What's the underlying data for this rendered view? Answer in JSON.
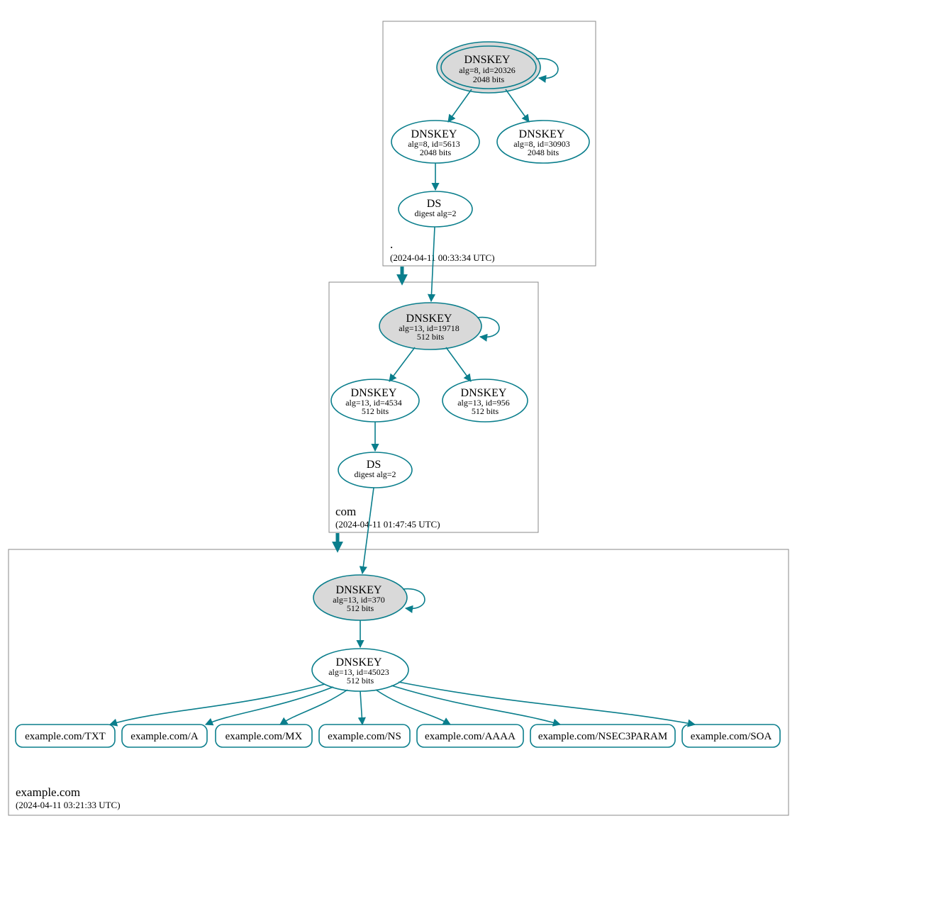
{
  "colors": {
    "edge": "#0a7e8c",
    "ksk_fill": "#d9d9d9",
    "box_stroke": "#888888"
  },
  "zones": {
    "root": {
      "name": ".",
      "timestamp": "(2024-04-11 00:33:34 UTC)"
    },
    "com": {
      "name": "com",
      "timestamp": "(2024-04-11 01:47:45 UTC)"
    },
    "example": {
      "name": "example.com",
      "timestamp": "(2024-04-11 03:21:33 UTC)"
    }
  },
  "nodes": {
    "root_ksk": {
      "title": "DNSKEY",
      "l2": "alg=8, id=20326",
      "l3": "2048 bits"
    },
    "root_zsk1": {
      "title": "DNSKEY",
      "l2": "alg=8, id=5613",
      "l3": "2048 bits"
    },
    "root_zsk2": {
      "title": "DNSKEY",
      "l2": "alg=8, id=30903",
      "l3": "2048 bits"
    },
    "root_ds": {
      "title": "DS",
      "l2": "digest alg=2",
      "l3": ""
    },
    "com_ksk": {
      "title": "DNSKEY",
      "l2": "alg=13, id=19718",
      "l3": "512 bits"
    },
    "com_zsk1": {
      "title": "DNSKEY",
      "l2": "alg=13, id=4534",
      "l3": "512 bits"
    },
    "com_zsk2": {
      "title": "DNSKEY",
      "l2": "alg=13, id=956",
      "l3": "512 bits"
    },
    "com_ds": {
      "title": "DS",
      "l2": "digest alg=2",
      "l3": ""
    },
    "ex_ksk": {
      "title": "DNSKEY",
      "l2": "alg=13, id=370",
      "l3": "512 bits"
    },
    "ex_zsk": {
      "title": "DNSKEY",
      "l2": "alg=13, id=45023",
      "l3": "512 bits"
    }
  },
  "rrsets": {
    "txt": "example.com/TXT",
    "a": "example.com/A",
    "mx": "example.com/MX",
    "ns": "example.com/NS",
    "aaaa": "example.com/AAAA",
    "nsec3": "example.com/NSEC3PARAM",
    "soa": "example.com/SOA"
  }
}
